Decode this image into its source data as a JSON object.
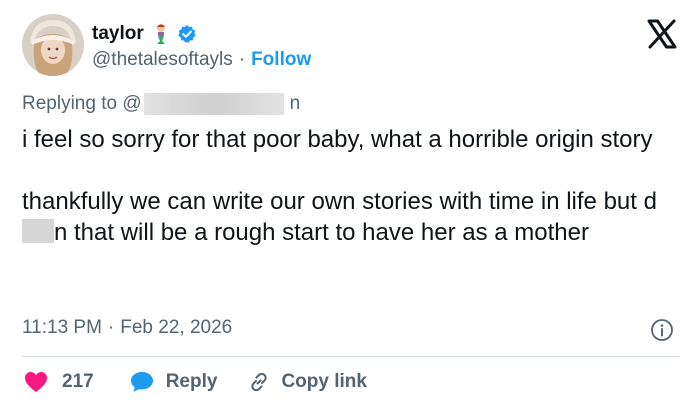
{
  "user": {
    "display_name": "taylor",
    "handle": "@thetalesoftayls",
    "separator": "·",
    "follow_label": "Follow",
    "verified_color": "#1d9bf0"
  },
  "reply": {
    "prefix": "Replying to @",
    "visible_suffix": "n"
  },
  "tweet": {
    "line1": "i feel so sorry for that poor baby, what a horrible origin story",
    "line2_start": "thankfully we can write our own stories with time in life but d",
    "line2_end": "n that will be a rough start to have her as a mother"
  },
  "meta": {
    "time": "11:13 PM",
    "separator": "·",
    "date": "Feb 22, 2026"
  },
  "actions": {
    "like_count": "217",
    "reply_label": "Reply",
    "copy_label": "Copy link"
  },
  "icons": {
    "logo": "x-logo-icon",
    "emoji": "mermaid-emoji-icon",
    "verified": "verified-badge-icon",
    "info": "info-icon",
    "like": "heart-icon",
    "reply": "reply-bubble-icon",
    "copy": "link-icon"
  },
  "colors": {
    "text": "#0f1419",
    "secondary": "#536471",
    "accent": "#1d9bf0",
    "like": "#f91880"
  }
}
